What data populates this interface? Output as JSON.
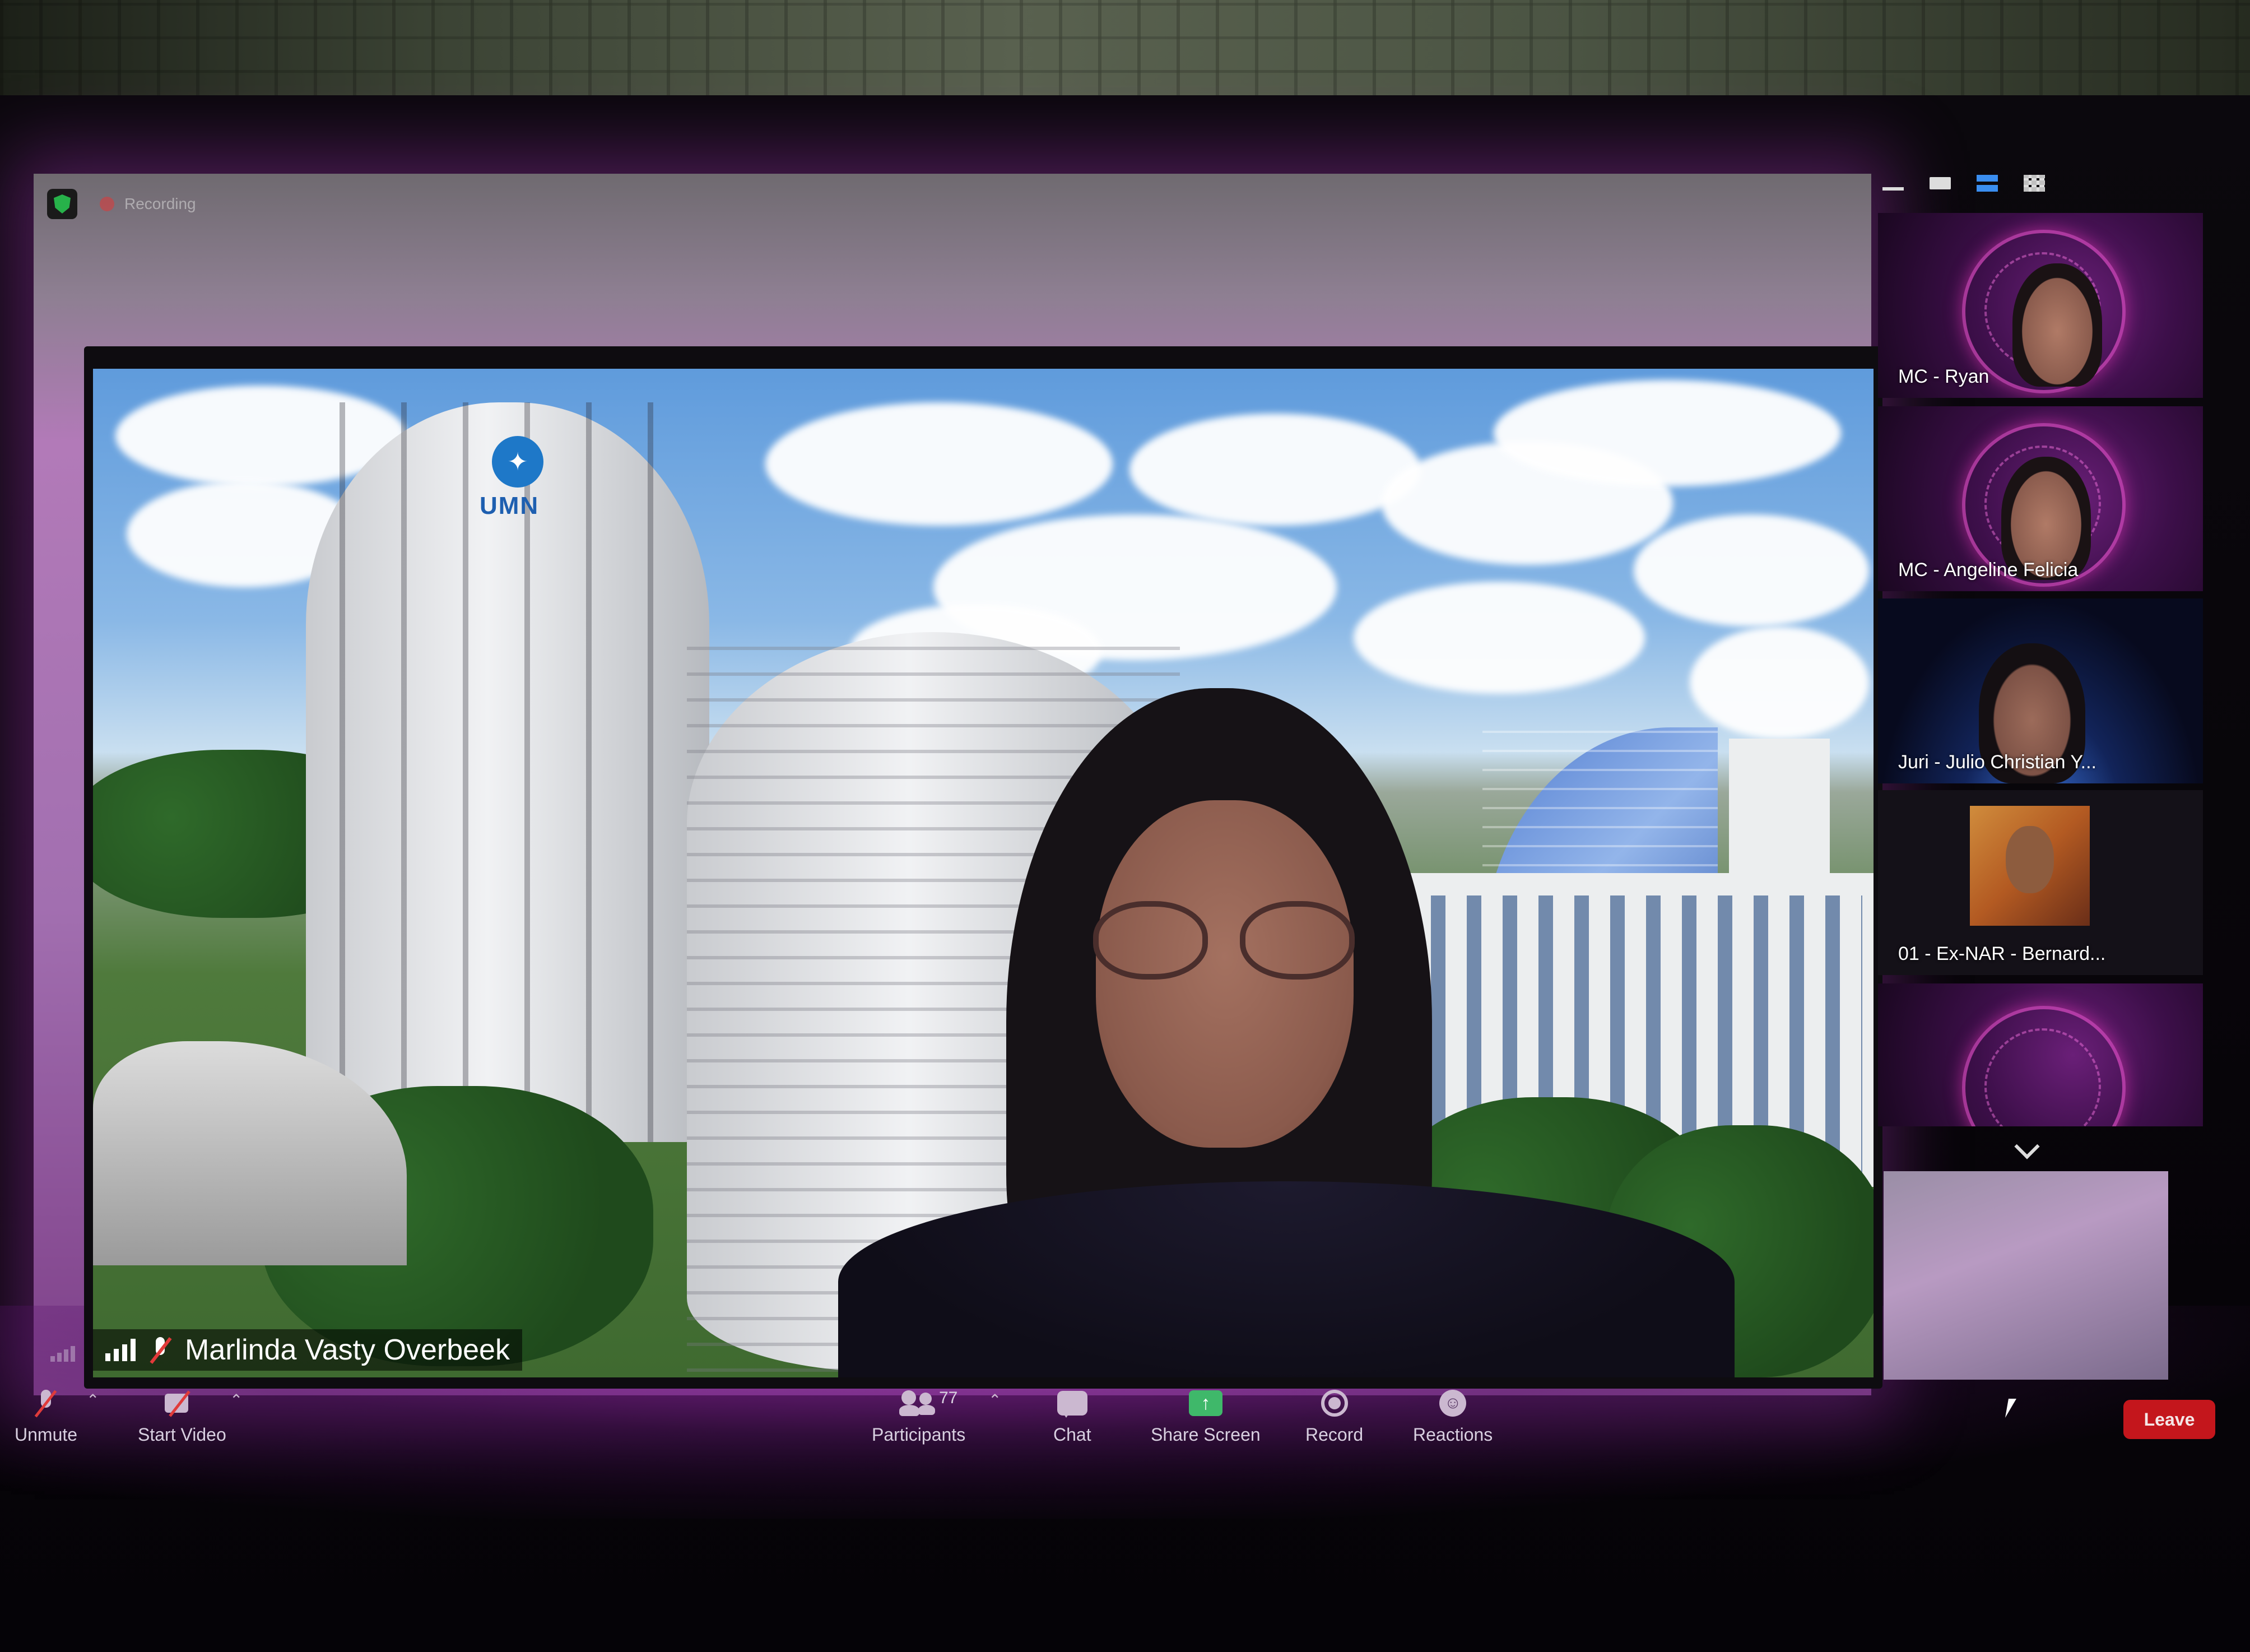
{
  "status": {
    "recording_label": "Recording",
    "shield_icon": "security-shield-icon",
    "record_dot_color": "#e13838"
  },
  "speaker": {
    "name": "Marlinda Vasty Overbeek",
    "mic_state": "muted",
    "signal_icon": "signal-bars-icon",
    "mic_icon": "mic-muted-icon"
  },
  "main_video": {
    "background_logo_text": "UMN"
  },
  "gallery": {
    "view_controls": [
      "minimize-icon",
      "speaker-view-icon",
      "strip-view-icon",
      "gallery-view-icon"
    ],
    "participants": [
      {
        "label": "MC - Ryan"
      },
      {
        "label": "MC - Angeline Felicia"
      },
      {
        "label": "Juri - Julio Christian Y..."
      },
      {
        "label": "01 - Ex-NAR - Bernard..."
      },
      {
        "label": ""
      }
    ],
    "scroll_icon": "chevron-down-icon"
  },
  "toolbar": {
    "unmute_label": "Unmute",
    "start_video_label": "Start Video",
    "participants_label": "Participants",
    "participants_count": "77",
    "chat_label": "Chat",
    "share_screen_label": "Share Screen",
    "record_label": "Record",
    "reactions_label": "Reactions",
    "leave_label": "Leave",
    "share_color": "#3fb86a",
    "leave_color": "#c4161c"
  }
}
